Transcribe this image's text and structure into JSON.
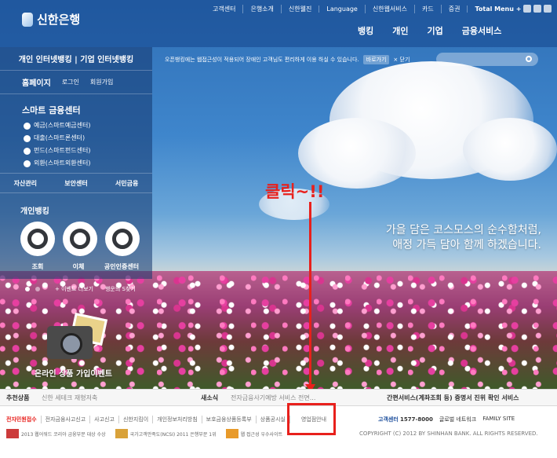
{
  "header": {
    "logo": "신한은행",
    "util_links": [
      "고객센터",
      "은행소개",
      "신한웰진",
      "Language",
      "신한웹서비스",
      "카드",
      "증권"
    ],
    "total_menu": "Total Menu  +",
    "main_nav": [
      "뱅킹",
      "개인",
      "기업",
      "금융서비스"
    ]
  },
  "left_panel": {
    "banking": "개인 인터넷뱅킹  |  기업 인터넷뱅킹",
    "home": "홈페이지",
    "login": "로그인",
    "join": "회원가입",
    "smart_center": "스마트 금융센터",
    "smart_items": [
      "예금(스마트예금센터)",
      "대출(스마트론센터)",
      "펀드(스마트펀드센터)",
      "외환(스마트외환센터)"
    ],
    "quick_links": [
      "자산관리",
      "보안센터",
      "서민금융"
    ],
    "personal_banking": "개인뱅킹",
    "circle_labels": [
      "조회",
      "이체",
      "공인인증센터"
    ]
  },
  "notice": {
    "text": "오픈뱅킹에는 웹접근성이 적용되어 장애인 고객님도 편리하게 이용 하실 수 있습니다.",
    "goto": "바로가기",
    "close": "닫기"
  },
  "hero": {
    "slogan_line1": "가을 담은 코스모스의 순수함처럼,",
    "slogan_line2": "애정 가득 담아 함께 하겠습니다."
  },
  "annotation": {
    "click_label": "클릭~!!"
  },
  "promo": {
    "event_more": "+ 이벤트 더보기",
    "haengun": "행운의 S찾기",
    "event_label": "온라인 상품 가입이벤트"
  },
  "footer": {
    "recommend_label": "추천상품",
    "recommend_text": "신한 세테크 재형저축",
    "news_label": "새소식",
    "news_text": "전자금융사기예방 서비스 전면...",
    "simple_service": "간편서비스(계좌조회 등) 증명서 진위 확인 서비스",
    "links": [
      "전자민원접수",
      "전자금융사고신고",
      "사고신고",
      "신한지킴이",
      "개인정보처리방침",
      "보호금융상품등록부",
      "상품공시실",
      "영업점안내"
    ],
    "customer_center": "고객센터",
    "phone": "1577-8000",
    "global_network": "글로벌 네트워크",
    "family_site": "FAMILY SITE",
    "awards": [
      "2013 웹어워드 코리아 금융부문 대상 수상",
      "국가고객만족도(NCSI) 2011 은행부문 1위",
      "웹 접근성 우수사이트"
    ],
    "copyright": "COPYRIGHT (C) 2012 BY SHINHAN BANK. ALL RIGHTS RESERVED."
  }
}
